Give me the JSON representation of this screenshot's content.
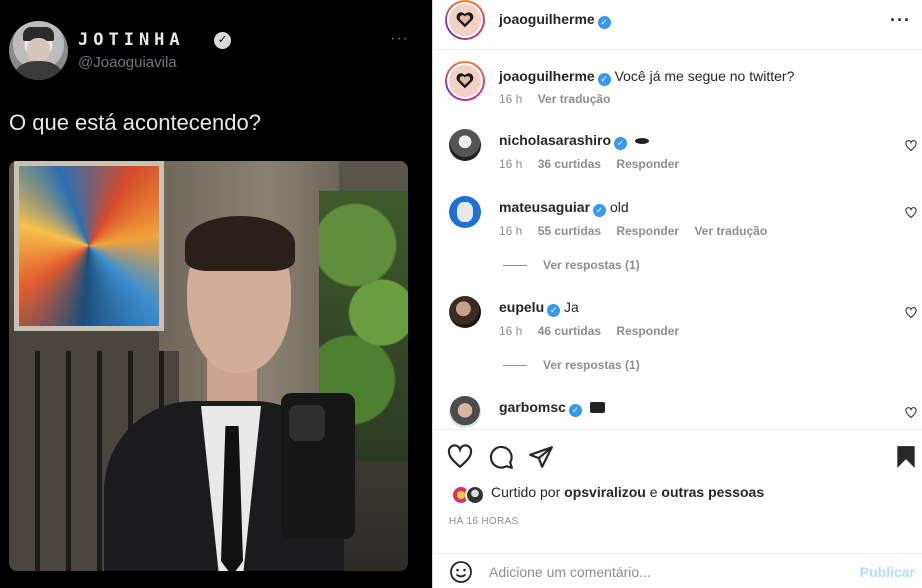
{
  "tweet": {
    "display_name": "JOTINHA",
    "handle": "@Joaoguiavila",
    "text": "O que está acontecendo?",
    "more": "···"
  },
  "post": {
    "author": "joaoguilherme",
    "more": "···",
    "caption_author": "joaoguilherme",
    "caption": "Você já me segue no twitter?",
    "caption_time": "16 h",
    "caption_translate": "Ver tradução"
  },
  "comments": [
    {
      "user": "nicholasarashiro",
      "text": "",
      "time": "16 h",
      "likes": "36 curtidas",
      "reply": "Responder",
      "translate": ""
    },
    {
      "user": "mateusaguiar",
      "text": "old",
      "time": "16 h",
      "likes": "55 curtidas",
      "reply": "Responder",
      "translate": "Ver tradução",
      "replies": "Ver respostas (1)"
    },
    {
      "user": "eupelu",
      "text": "Ja",
      "time": "16 h",
      "likes": "46 curtidas",
      "reply": "Responder",
      "translate": "",
      "replies": "Ver respostas (1)"
    },
    {
      "user": "garbomsc",
      "text": "",
      "time": "",
      "likes": "",
      "reply": "",
      "translate": ""
    }
  ],
  "likes_line": {
    "prefix": "Curtido por",
    "user": "opsviralizou",
    "connector": "e",
    "others": "outras pessoas"
  },
  "timestamp": "HÁ 16 HORAS",
  "add_comment": {
    "placeholder": "Adicione um comentário...",
    "publish": "Publicar"
  },
  "colors": {
    "verified": "#3897f0",
    "muted": "#8e8e8e",
    "publish": "#b2dffc",
    "twitter_bg": "#000000"
  },
  "icons": [
    "heart-icon",
    "comment-icon",
    "share-icon",
    "bookmark-icon",
    "emoji-icon",
    "verified-icon",
    "more-icon"
  ]
}
